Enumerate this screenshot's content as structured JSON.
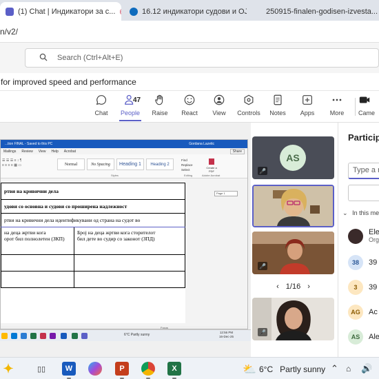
{
  "browser": {
    "tabs": [
      {
        "label": "(1) Chat | Индикатори за с...",
        "active": true
      },
      {
        "label": "16.12 индикатори судови и ОЈ...",
        "active": false
      },
      {
        "label": "250915-finalen-godisen-izvesta...",
        "active": false
      }
    ],
    "url": "n/v2/"
  },
  "teams": {
    "search_placeholder": "Search (Ctrl+Alt+E)",
    "notice": "for improved speed and performance",
    "toolbar": [
      {
        "label": "Chat",
        "icon": "chat-icon"
      },
      {
        "label": "People",
        "icon": "people-icon",
        "badge": "47",
        "active": true
      },
      {
        "label": "Raise",
        "icon": "raise-hand-icon"
      },
      {
        "label": "React",
        "icon": "react-icon"
      },
      {
        "label": "View",
        "icon": "view-icon"
      },
      {
        "label": "Controls",
        "icon": "controls-icon"
      },
      {
        "label": "Notes",
        "icon": "notes-icon"
      },
      {
        "label": "Apps",
        "icon": "apps-icon"
      },
      {
        "label": "More",
        "icon": "more-icon"
      },
      {
        "label": "Came",
        "icon": "camera-icon"
      }
    ]
  },
  "word": {
    "title": "...tion FINAL - Saved to this PC",
    "user": "Gordana Lazetic",
    "tabs": [
      "Mailings",
      "Review",
      "View",
      "Help",
      "Acrobat"
    ],
    "share": "Share",
    "styles": [
      "Normal",
      "No Spacing",
      "Heading 1",
      "Heading 2"
    ],
    "ribbon_groups": [
      "Styles",
      "Editing",
      "Adobe Acrobat"
    ],
    "ribbon_actions": [
      "Find",
      "Replace",
      "Select",
      "Create a PDF"
    ],
    "page_box": "Page 1",
    "table": {
      "row1": "ртви на кривични дела",
      "row2": "удови со основна и судови со проширена надлежност",
      "row3": "ртви на кривични дела идентификувани од страна на судот во",
      "col1": "на деца жртви кога\nорот бил полнолетен (ЗКП)",
      "col2": "Број на деца жртви кога сторителот\nбил дете во судир со законот (ЗПД)"
    },
    "statusbar": "Focus",
    "mini_taskbar_weather": "6°C  Partly sunny",
    "mini_clock": [
      "12:56 PM",
      "16-Dec-25"
    ]
  },
  "videos": {
    "tile1_initials": "AS",
    "pager": "1/16"
  },
  "panel": {
    "title": "Participa",
    "input_placeholder": "Type a n",
    "section": "In this me",
    "rows": [
      {
        "initials": "",
        "name": "Ele",
        "sub": "Org",
        "color": "#3a2a2a"
      },
      {
        "initials": "38",
        "name": "39",
        "color": "#d6e4f7"
      },
      {
        "initials": "3",
        "name": "39",
        "color": "#fde7c0"
      },
      {
        "initials": "AG",
        "name": "Ac",
        "color": "#fde7c0"
      },
      {
        "initials": "AS",
        "name": "Ale",
        "color": "#d8ecd8"
      }
    ]
  },
  "taskbar": {
    "weather": "6°C   Partly sunny"
  },
  "colors": {
    "teams_accent": "#5b5fc7",
    "word_blue": "#185abd"
  }
}
